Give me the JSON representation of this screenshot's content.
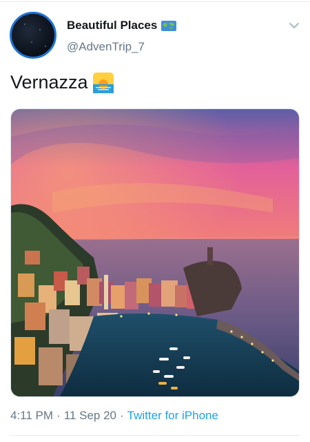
{
  "user": {
    "display_name": "Beautiful Places",
    "handle": "@AdvenTrip_7",
    "name_emoji": "world-map-icon"
  },
  "tweet": {
    "text": "Vernazza",
    "text_emoji": "sunrise-icon"
  },
  "media": {
    "description_icon": "photo"
  },
  "meta": {
    "time": "4:11 PM",
    "separator1": "·",
    "date": "11 Sep 20",
    "separator2": "·",
    "source": "Twitter for iPhone"
  },
  "colors": {
    "link": "#1da1f2",
    "secondary_text": "#657786",
    "avatar_ring": "#1d74d6"
  }
}
